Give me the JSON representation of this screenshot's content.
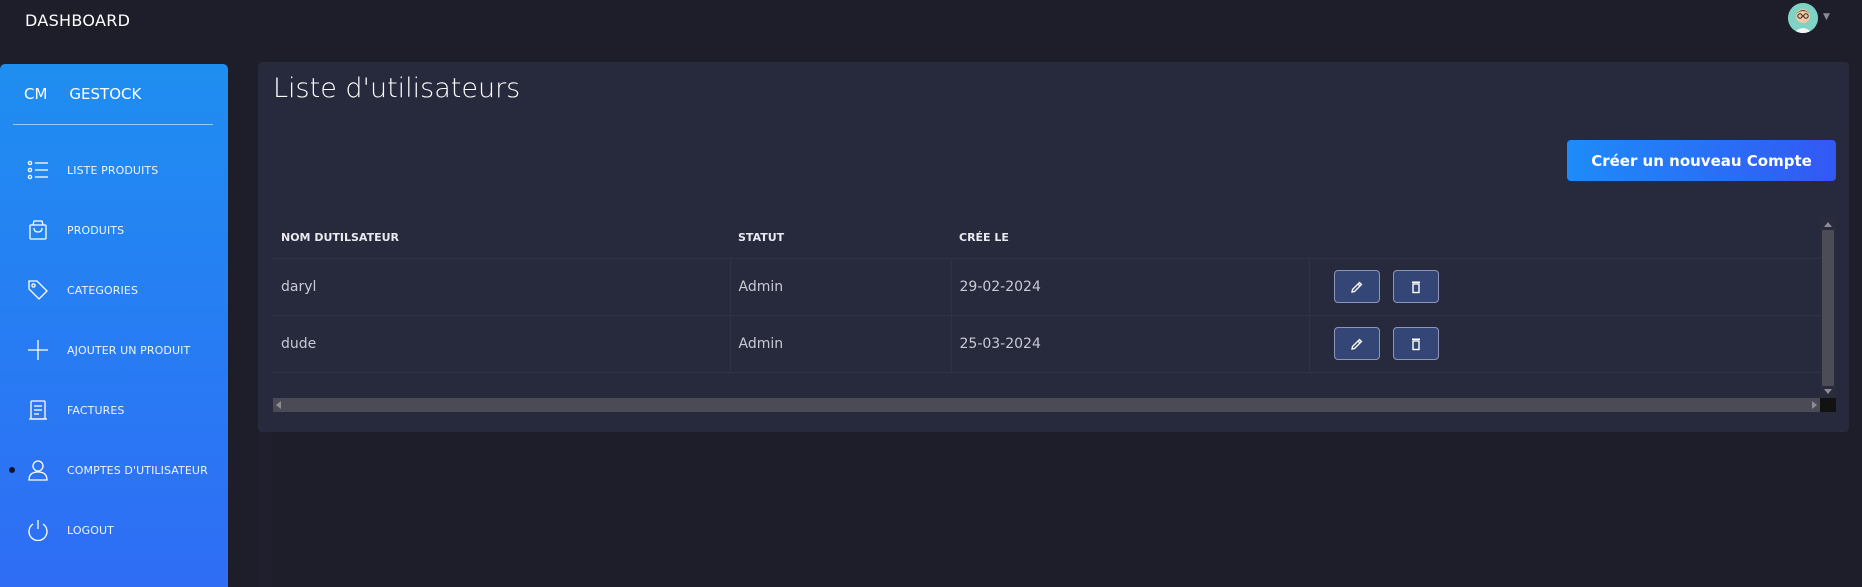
{
  "topbar": {
    "brand": "DASHBOARD",
    "avatar_icon": "user-avatar-icon"
  },
  "sidebar": {
    "logo_mini": "CM",
    "logo_text": "GESTOCK",
    "items": [
      {
        "label": "LISTE PRODUITS",
        "icon": "list-icon"
      },
      {
        "label": "PRODUITS",
        "icon": "shopping-bag-icon"
      },
      {
        "label": "CATEGORIES",
        "icon": "tag-icon"
      },
      {
        "label": "AJOUTER UN PRODUIT",
        "icon": "plus-icon"
      },
      {
        "label": "FACTURES",
        "icon": "receipt-icon"
      },
      {
        "label": "COMPTES D'UTILISATEUR",
        "icon": "user-icon",
        "active": true
      },
      {
        "label": "LOGOUT",
        "icon": "power-icon"
      }
    ]
  },
  "main": {
    "title": "Liste d'utilisateurs",
    "create_button": "Créer un nouveau Compte",
    "table": {
      "headers": [
        "NOM DUTILSATEUR",
        "STATUT",
        "CRÉE LE",
        ""
      ],
      "rows": [
        {
          "username": "daryl",
          "status": "Admin",
          "created": "29-02-2024"
        },
        {
          "username": "dude",
          "status": "Admin",
          "created": "25-03-2024"
        }
      ]
    }
  },
  "colors": {
    "background": "#1e1e2b",
    "card": "#27293d",
    "sidebar_top": "#1f8ef1",
    "sidebar_bottom": "#2f6df5",
    "accent": "#3358f4"
  }
}
